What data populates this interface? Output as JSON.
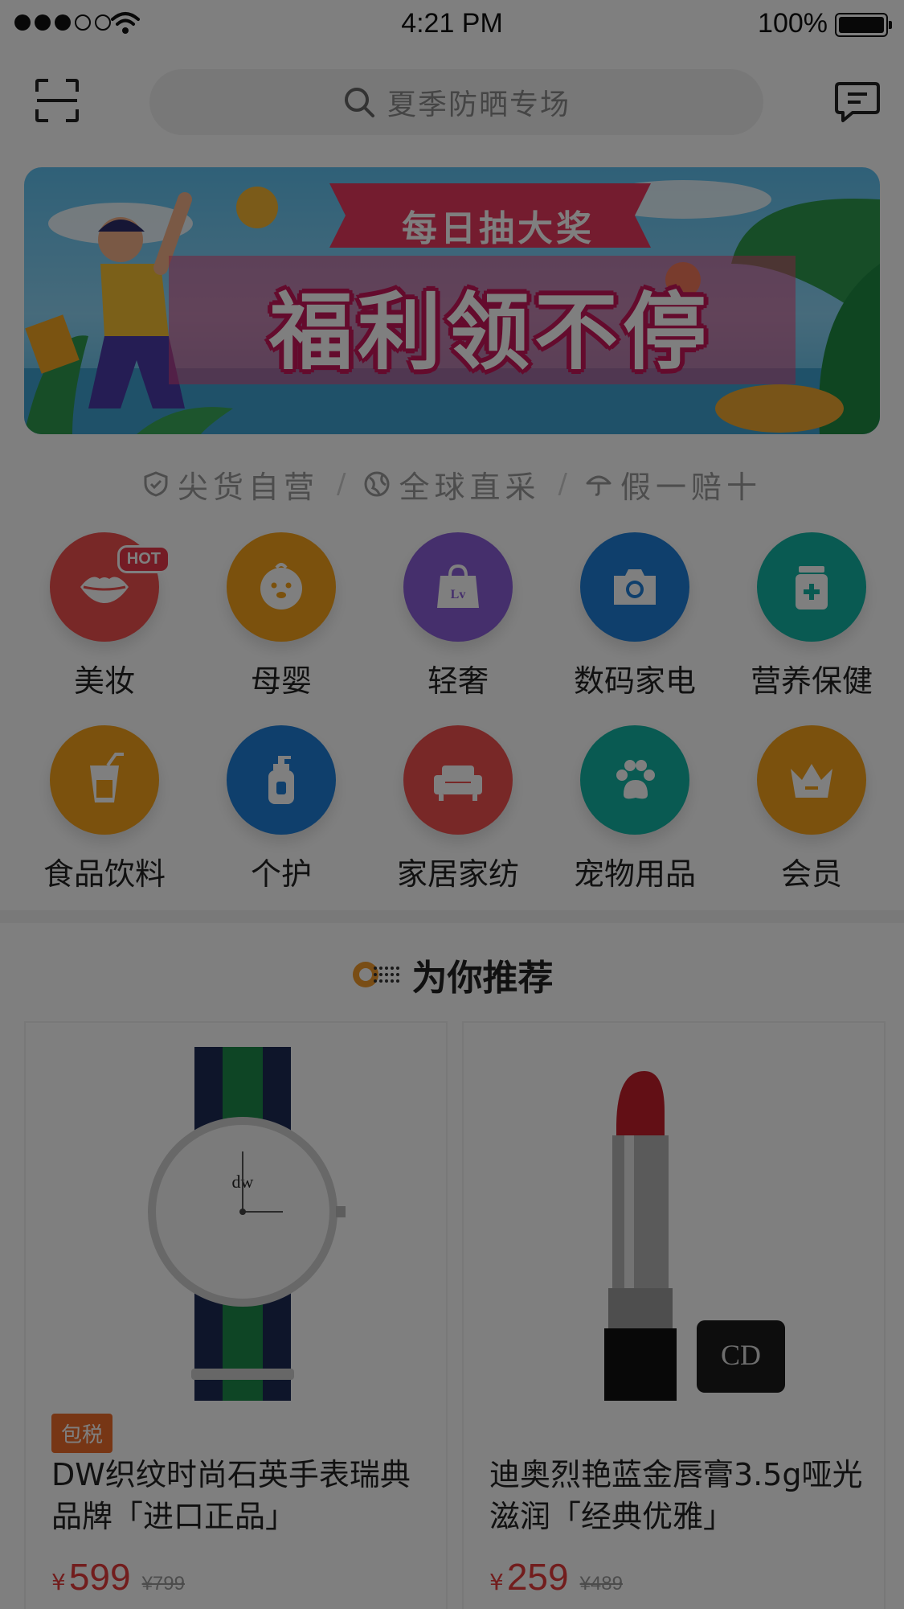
{
  "status_bar": {
    "time": "4:21 PM",
    "battery": "100%"
  },
  "header": {
    "search_placeholder": "夏季防晒专场",
    "scan_icon": "scan-icon",
    "message_icon": "message-icon"
  },
  "banner": {
    "subtitle": "每日抽大奖",
    "title": "福利领不停"
  },
  "guarantees": [
    {
      "icon": "shield-icon",
      "label": "尖货自营"
    },
    {
      "icon": "globe-icon",
      "label": "全球直采"
    },
    {
      "icon": "umbrella-icon",
      "label": "假一赔十"
    }
  ],
  "categories": [
    {
      "label": "美妆",
      "icon": "lips-icon",
      "color": "#f0504f",
      "badge": "HOT"
    },
    {
      "label": "母婴",
      "icon": "baby-icon",
      "color": "#f7a21b"
    },
    {
      "label": "轻奢",
      "icon": "bag-icon",
      "color": "#8b5fd8"
    },
    {
      "label": "数码家电",
      "icon": "camera-icon",
      "color": "#1f7ed8"
    },
    {
      "label": "营养保健",
      "icon": "medicine-icon",
      "color": "#12b5a4"
    },
    {
      "label": "食品饮料",
      "icon": "drink-icon",
      "color": "#f7a21b"
    },
    {
      "label": "个护",
      "icon": "lotion-icon",
      "color": "#1f7ed8"
    },
    {
      "label": "家居家纺",
      "icon": "sofa-icon",
      "color": "#f0504f"
    },
    {
      "label": "宠物用品",
      "icon": "paw-icon",
      "color": "#12b5a4"
    },
    {
      "label": "会员",
      "icon": "crown-icon",
      "color": "#f7a21b"
    }
  ],
  "recommend": {
    "title": "为你推荐"
  },
  "products": [
    {
      "badge": "包税",
      "name": "DW织纹时尚石英手表瑞典品牌「进口正品」",
      "currency": "¥",
      "price": "599",
      "original_price": "¥799",
      "image_icon": "watch-icon"
    },
    {
      "badge": "",
      "name": "迪奥烈艳蓝金唇膏3.5g哑光滋润「经典优雅」",
      "currency": "¥",
      "price": "259",
      "original_price": "¥489",
      "image_icon": "lipstick-icon"
    }
  ]
}
